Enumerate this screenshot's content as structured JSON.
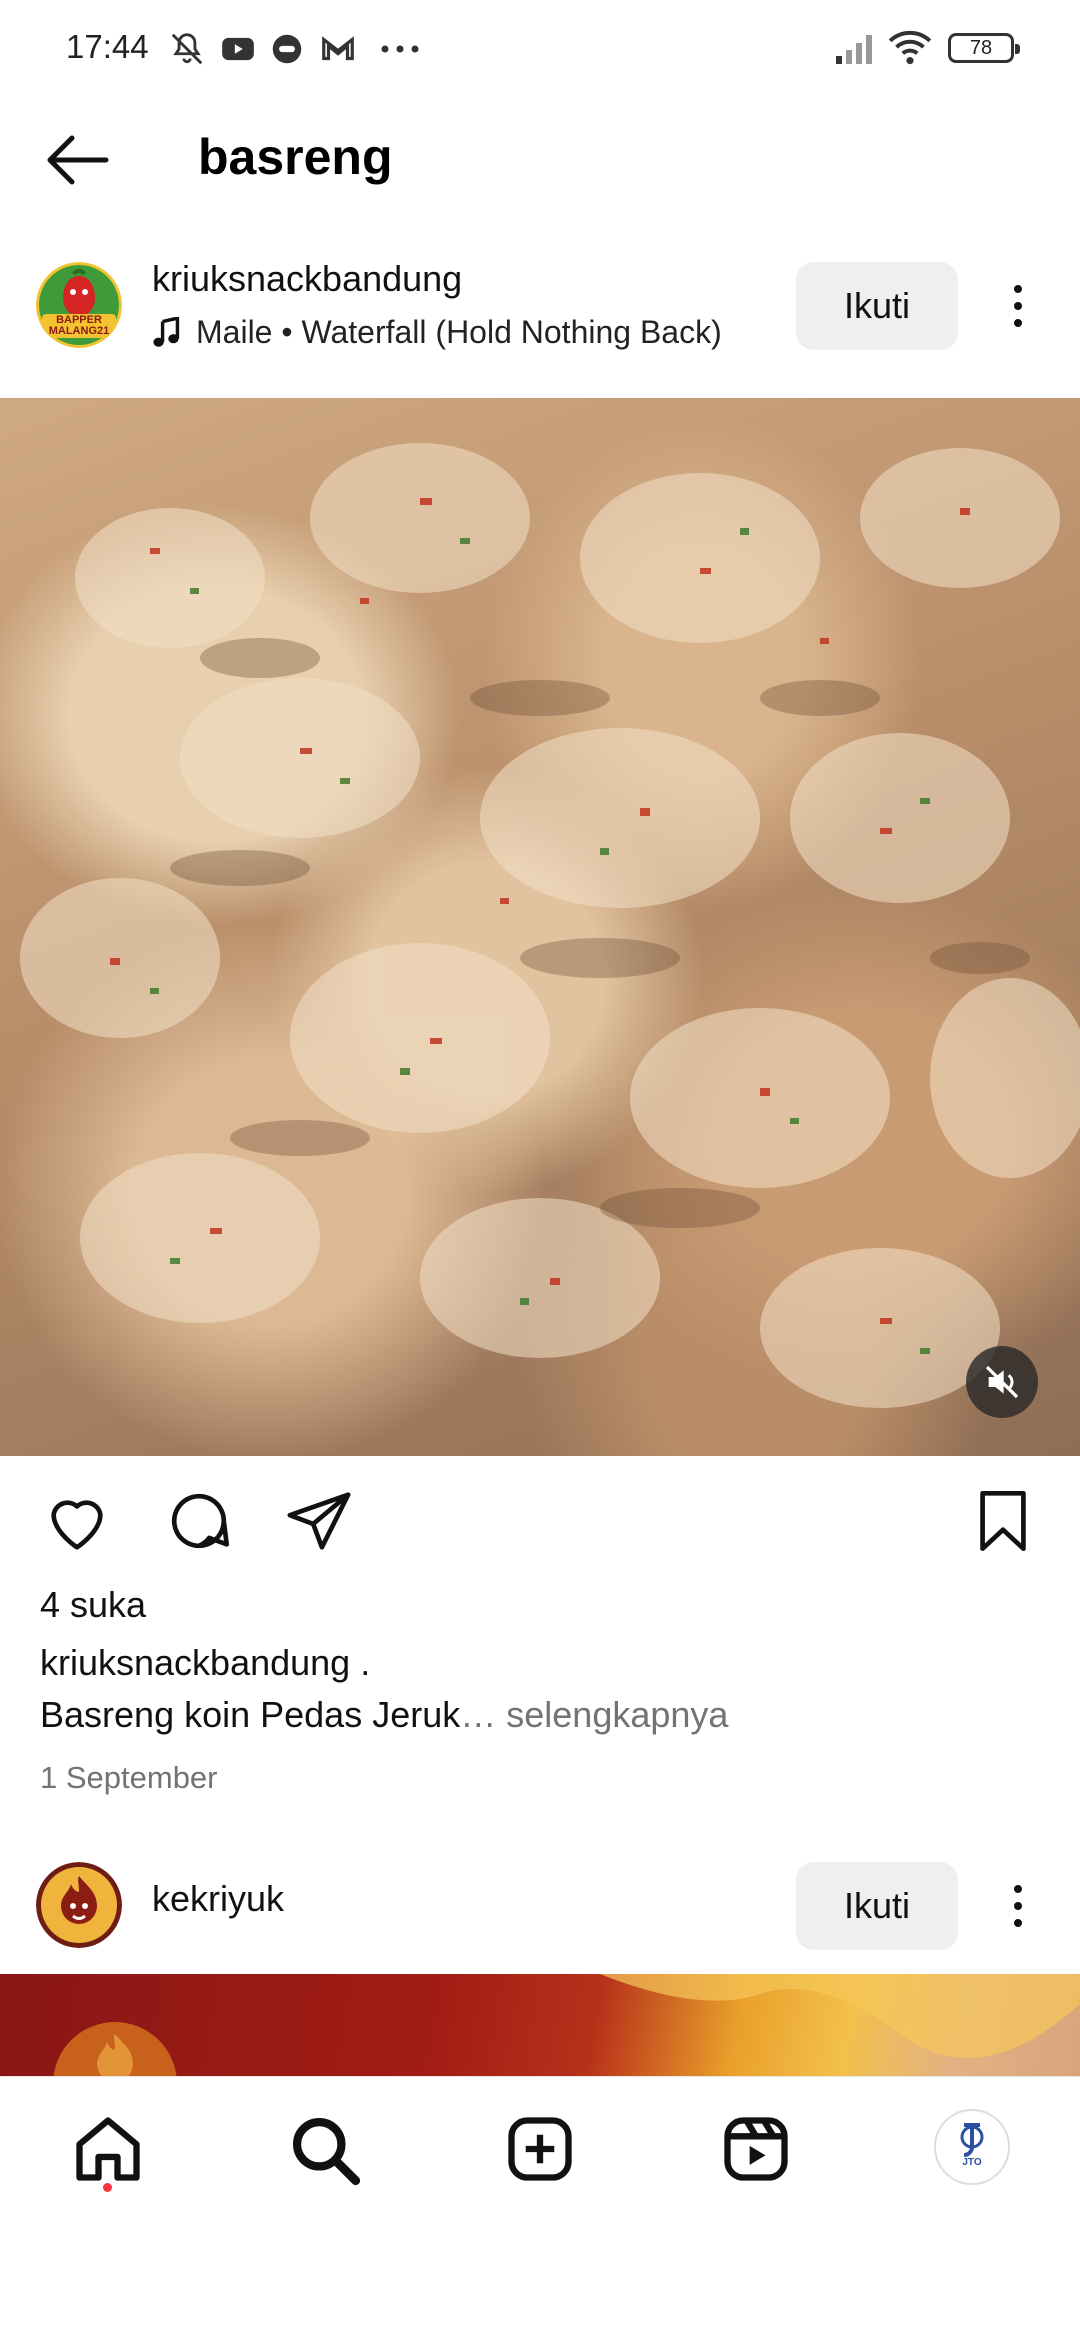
{
  "status_bar": {
    "time": "17:44",
    "battery": "78",
    "icons": [
      "mute-icon",
      "youtube-icon",
      "chat-bubble-icon",
      "gmail-icon",
      "more-dots-icon",
      "signal-icon",
      "wifi-icon"
    ]
  },
  "header": {
    "title": "basreng"
  },
  "post1": {
    "avatar_text": "BAPPER MALANG21",
    "username": "kriuksnackbandung",
    "music": "Maile • Waterfall (Hold Nothing Back)",
    "follow_label": "Ikuti",
    "likes": "4 suka",
    "caption_user": "kriuksnackbandung .",
    "caption_text": "Basreng koin Pedas Jeruk",
    "caption_more": "… selengkapnya",
    "date": "1 September"
  },
  "post2": {
    "username": "kekriyuk",
    "follow_label": "Ikuti"
  },
  "profile_avatar_text": "JTO",
  "colors": {
    "follow_bg": "#efefef",
    "muted_text": "#737373",
    "notification_dot": "#ff3040"
  }
}
